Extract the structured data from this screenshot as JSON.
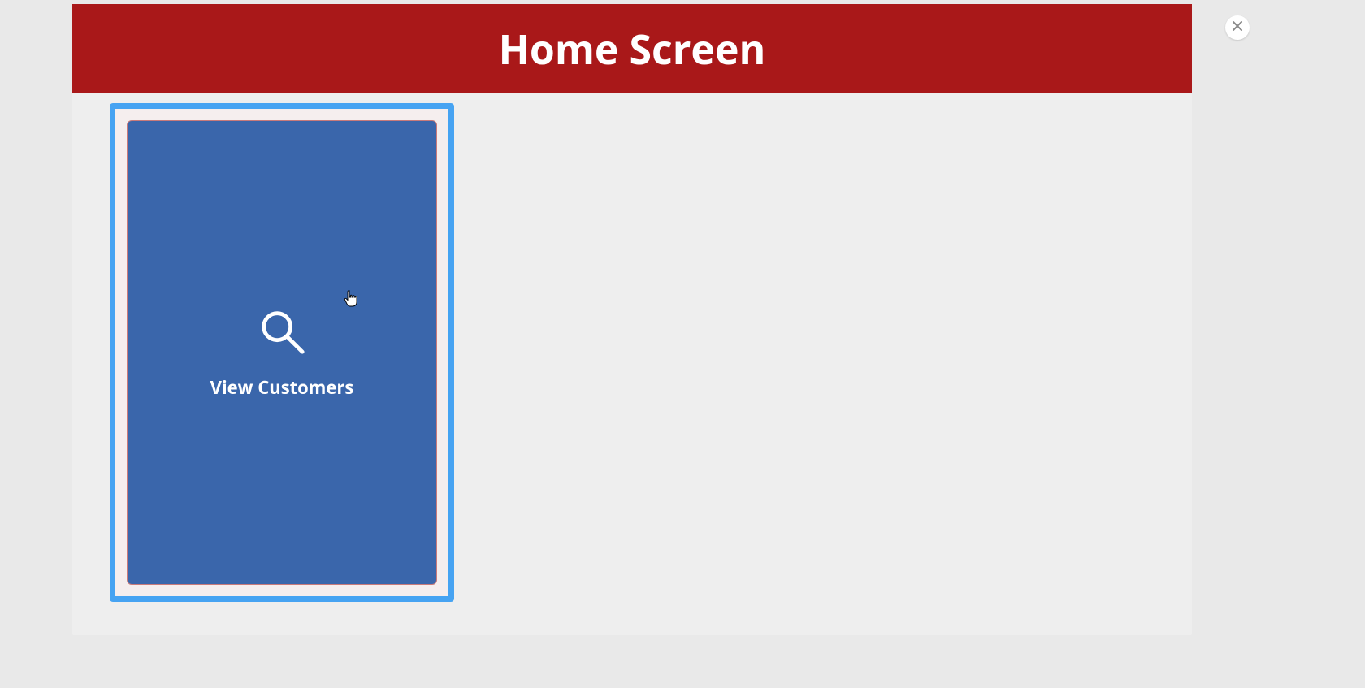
{
  "header": {
    "title": "Home Screen"
  },
  "tiles": [
    {
      "label": "View Customers",
      "icon": "search-icon"
    }
  ],
  "colors": {
    "header_bg": "#a91819",
    "tile_bg": "#3a66ab",
    "tile_highlight": "#46a3f2",
    "page_bg": "#e9e9e9",
    "card_bg": "#eeeeee"
  }
}
